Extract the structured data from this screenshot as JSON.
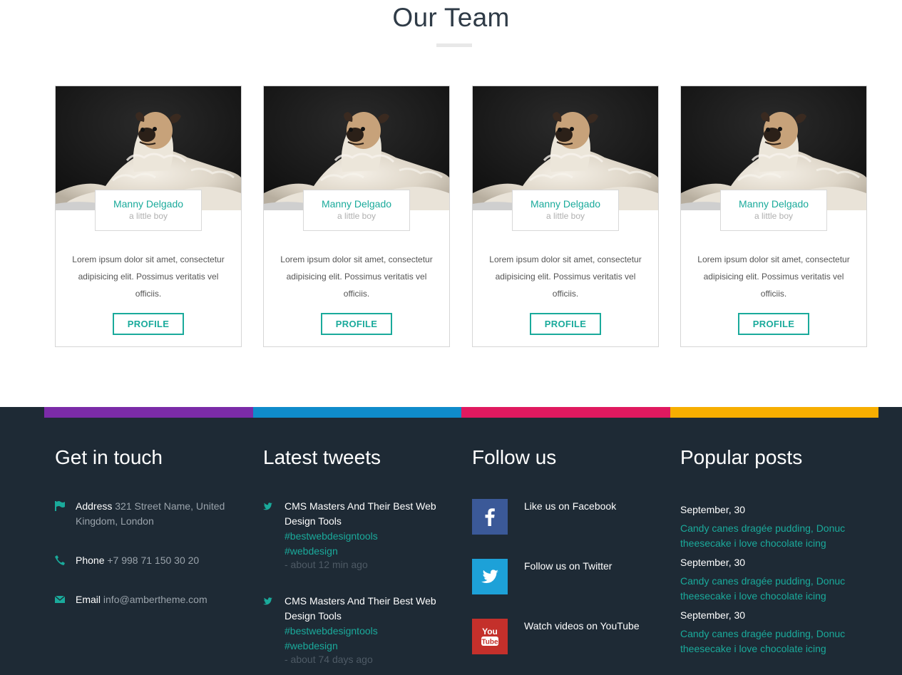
{
  "team": {
    "title": "Our Team",
    "members": [
      {
        "name": "Manny Delgado",
        "role": "a little boy",
        "bio": "Lorem ipsum dolor sit amet, consectetur adipisicing elit. Possimus veritatis vel officiis.",
        "button": "PROFILE"
      },
      {
        "name": "Manny Delgado",
        "role": "a little boy",
        "bio": "Lorem ipsum dolor sit amet, consectetur adipisicing elit. Possimus veritatis vel officiis.",
        "button": "PROFILE"
      },
      {
        "name": "Manny Delgado",
        "role": "a little boy",
        "bio": "Lorem ipsum dolor sit amet, consectetur adipisicing elit. Possimus veritatis vel officiis.",
        "button": "PROFILE"
      },
      {
        "name": "Manny Delgado",
        "role": "a little boy",
        "bio": "Lorem ipsum dolor sit amet, consectetur adipisicing elit. Possimus veritatis vel officiis.",
        "button": "PROFILE"
      }
    ]
  },
  "footer": {
    "strip_colors": [
      "#7b2ba8",
      "#0f8ccb",
      "#e0195f",
      "#f7ae00"
    ],
    "contact": {
      "title": "Get in touch",
      "items": [
        {
          "icon": "flag-icon",
          "label": "Address",
          "value": "321 Street Name, United Kingdom, London"
        },
        {
          "icon": "phone-icon",
          "label": "Phone",
          "value": "+7 998 71 150 30 20"
        },
        {
          "icon": "envelope-icon",
          "label": "Email",
          "value": "info@ambertheme.com"
        }
      ]
    },
    "tweets": {
      "title": "Latest tweets",
      "items": [
        {
          "icon": "twitter-bird-icon",
          "text": "CMS Masters And Their Best Web Design Tools",
          "tags": [
            "#bestwebdesigntools",
            "#webdesign"
          ],
          "time": "- about 12 min ago"
        },
        {
          "icon": "twitter-bird-icon",
          "text": "CMS Masters And Their Best Web Design Tools",
          "tags": [
            "#bestwebdesigntools",
            "#webdesign"
          ],
          "time": "- about 74 days ago"
        }
      ]
    },
    "follow": {
      "title": "Follow us",
      "items": [
        {
          "icon": "facebook-icon",
          "label": "Like us on Facebook",
          "color": "#3b5998"
        },
        {
          "icon": "twitter-icon",
          "label": "Follow us on Twitter",
          "color": "#1da1d8"
        },
        {
          "icon": "youtube-icon",
          "label": "Watch videos on YouTube",
          "color": "#c4302b"
        }
      ]
    },
    "posts": {
      "title": "Popular posts",
      "items": [
        {
          "date": "September, 30",
          "title": "Candy canes dragée pudding, Donuc theesecake i love chocolate icing"
        },
        {
          "date": "September, 30",
          "title": "Candy canes dragée pudding, Donuc theesecake i love chocolate icing"
        },
        {
          "date": "September, 30",
          "title": "Candy canes dragée pudding, Donuc theesecake i love chocolate icing"
        }
      ]
    }
  }
}
